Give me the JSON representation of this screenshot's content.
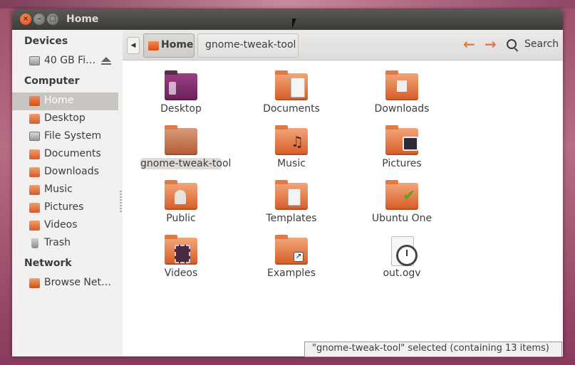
{
  "window": {
    "title": "Home"
  },
  "sidebar": {
    "sections": {
      "devices": "Devices",
      "computer": "Computer",
      "network": "Network"
    },
    "devices": [
      {
        "label": "40 GB Fi…",
        "icon": "drive-icon"
      }
    ],
    "computer": [
      {
        "label": "Home",
        "icon": "home-icon",
        "selected": true
      },
      {
        "label": "Desktop",
        "icon": "folder-icon"
      },
      {
        "label": "File System",
        "icon": "drive-icon"
      },
      {
        "label": "Documents",
        "icon": "folder-icon"
      },
      {
        "label": "Downloads",
        "icon": "folder-icon"
      },
      {
        "label": "Music",
        "icon": "folder-icon"
      },
      {
        "label": "Pictures",
        "icon": "folder-icon"
      },
      {
        "label": "Videos",
        "icon": "folder-icon"
      },
      {
        "label": "Trash",
        "icon": "trash-icon"
      }
    ],
    "network": [
      {
        "label": "Browse Net…",
        "icon": "network-icon"
      }
    ]
  },
  "toolbar": {
    "breadcrumbs": [
      "Home",
      "gnome-tweak-tool"
    ],
    "search_label": "Search"
  },
  "files": [
    {
      "name": "Desktop",
      "type": "desktop-folder"
    },
    {
      "name": "Documents",
      "type": "folder"
    },
    {
      "name": "Downloads",
      "type": "folder"
    },
    {
      "name": "gnome-tweak-tool",
      "type": "folder",
      "selected": true
    },
    {
      "name": "Music",
      "type": "folder"
    },
    {
      "name": "Pictures",
      "type": "folder"
    },
    {
      "name": "Public",
      "type": "folder"
    },
    {
      "name": "Templates",
      "type": "folder"
    },
    {
      "name": "Ubuntu One",
      "type": "folder"
    },
    {
      "name": "Videos",
      "type": "folder"
    },
    {
      "name": "Examples",
      "type": "folder"
    },
    {
      "name": "out.ogv",
      "type": "video-file"
    }
  ],
  "status": {
    "text": "\"gnome-tweak-tool\" selected (containing 13 items)"
  },
  "colors": {
    "accent": "#e5773b",
    "selection": "#c9c6c2",
    "titlebar": "#3c3b37"
  }
}
